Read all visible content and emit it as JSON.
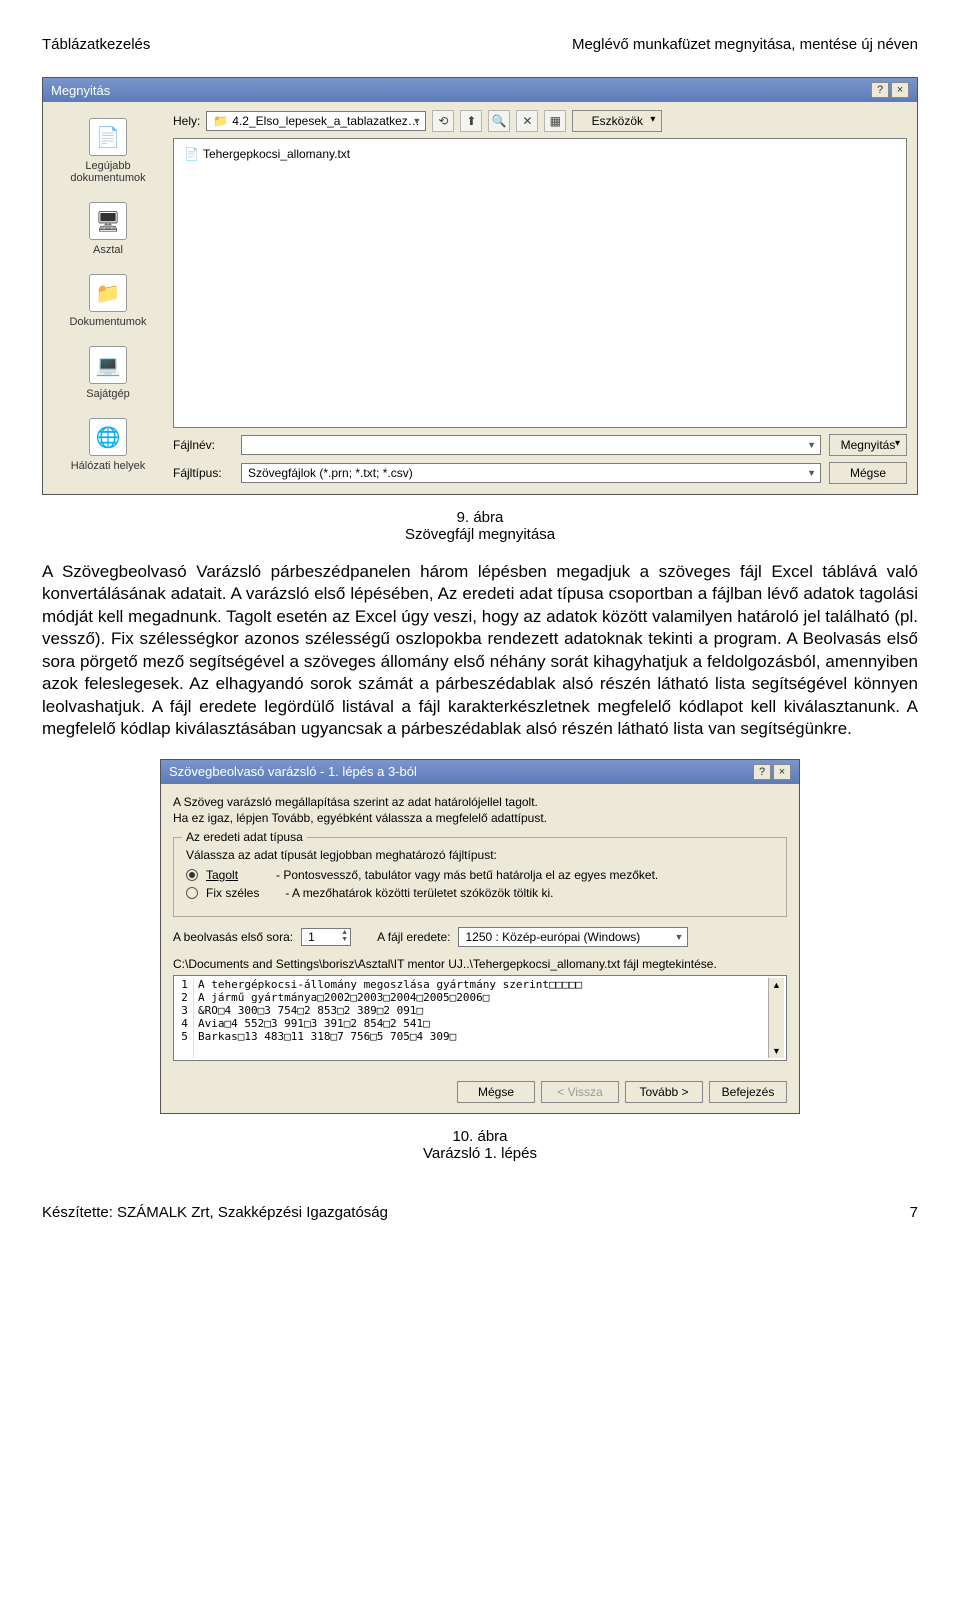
{
  "header": {
    "left": "Táblázatkezelés",
    "right": "Meglévő munkafüzet megnyitása, mentése új néven"
  },
  "dialog1": {
    "title": "Megnyitás",
    "help_icon": "?",
    "close_icon": "×",
    "hely_label": "Hely:",
    "hely_value": "4.2_Elso_lepesek_a_tablazatkez…",
    "tools_label": "Eszközök",
    "sidebar": [
      {
        "icon": "📄",
        "label": "Legújabb dokumentumok"
      },
      {
        "icon": "🖥",
        "label": "Asztal"
      },
      {
        "icon": "📁",
        "label": "Dokumentumok"
      },
      {
        "icon": "💻",
        "label": "Sajátgép"
      },
      {
        "icon": "🌐",
        "label": "Hálózati helyek"
      }
    ],
    "file": {
      "icon": "📄",
      "name": "Tehergepkocsi_allomany.txt"
    },
    "filename_label": "Fájlnév:",
    "filename_value": "",
    "filetype_label": "Fájltípus:",
    "filetype_value": "Szövegfájlok (*.prn; *.txt; *.csv)",
    "open_btn": "Megnyitás",
    "cancel_btn": "Mégse"
  },
  "fig1": {
    "num": "9. ábra",
    "caption": "Szövegfájl megnyitása"
  },
  "para1": "A Szövegbeolvasó Varázsló párbeszédpanelen három lépésben megadjuk a szöveges fájl Excel táblává való konvertálásának adatait. A varázsló első lépésében, Az eredeti adat típusa csoportban a fájlban lévő adatok tagolási módját kell megadnunk. Tagolt esetén az Excel úgy veszi, hogy az adatok között valamilyen határoló jel található (pl. vessző). Fix szélességkor azonos szélességű oszlopokba rendezett adatoknak tekinti a program. A Beolvasás első sora pörgető mező segítségével a szöveges állomány első néhány sorát kihagyhatjuk a feldolgozásból, amennyiben azok feleslegesek. Az elhagyandó sorok számát a párbeszédablak alsó részén látható lista segítségével könnyen leolvashatjuk. A fájl eredete legördülő listával a fájl karakterkészletnek megfelelő kódlapot kell kiválasztanunk. A megfelelő kódlap kiválasztásában ugyancsak a párbeszédablak alsó részén látható lista van segítségünkre.",
  "dialog2": {
    "title": "Szövegbeolvasó varázsló - 1. lépés a 3-ból",
    "intro1": "A Szöveg varázsló megállapítása szerint az adat határolójellel tagolt.",
    "intro2": "Ha ez igaz, lépjen Tovább, egyébként válassza a megfelelő adattípust.",
    "legend": "Az eredeti adat típusa",
    "lead": "Válassza az adat típusát legjobban meghatározó fájltípust:",
    "opt1_label": "Tagolt",
    "opt1_desc": "- Pontosvessző, tabulátor vagy más betű határolja el az egyes mezőket.",
    "opt2_label": "Fix széles",
    "opt2_desc": "- A mezőhatárok közötti területet szóközök töltik ki.",
    "firstrow_label": "A beolvasás első sora:",
    "firstrow_value": "1",
    "origin_label": "A fájl eredete:",
    "origin_value": "1250 : Közép-európai (Windows)",
    "preview_label": "C:\\Documents and Settings\\borisz\\Asztal\\IT mentor UJ..\\Tehergepkocsi_allomany.txt fájl megtekintése.",
    "preview_lines": [
      "A tehergépkocsi-állomány megoszlása gyártmány szerint□□□□□",
      "A jármű gyártmánya□2002□2003□2004□2005□2006□",
      "&RO□4 300□3 754□2 853□2 389□2 091□",
      "Avia□4 552□3 991□3 391□2 854□2 541□",
      "Barkas□13 483□11 318□7 756□5 705□4 309□"
    ],
    "btn_cancel": "Mégse",
    "btn_back": "< Vissza",
    "btn_next": "Tovább >",
    "btn_finish": "Befejezés"
  },
  "fig2": {
    "num": "10. ábra",
    "caption": "Varázsló 1. lépés"
  },
  "footer": {
    "left": "Készítette: SZÁMALK Zrt, Szakképzési Igazgatóság",
    "right": "7"
  }
}
